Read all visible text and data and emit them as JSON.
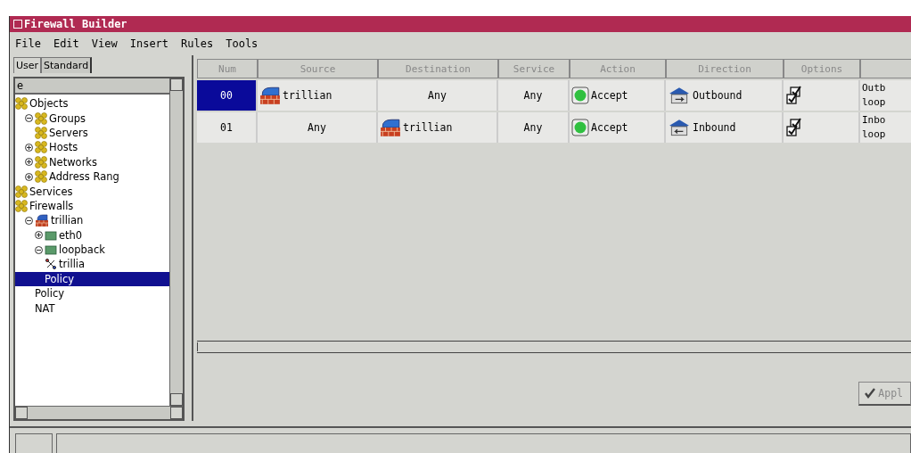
{
  "window": {
    "title": "Firewall Builder"
  },
  "menu": [
    "File",
    "Edit",
    "View",
    "Insert",
    "Rules",
    "Tools"
  ],
  "tabs": [
    {
      "label": "User",
      "selected": false
    },
    {
      "label": "Standard",
      "selected": true
    }
  ],
  "tree_header": "e",
  "tree": [
    {
      "label": "Objects",
      "kind": "group",
      "selected": false,
      "children": [
        {
          "label": "Groups",
          "kind": "group",
          "selected": false,
          "expanded": true,
          "children": [
            {
              "label": "Servers",
              "kind": "group",
              "selected": false
            }
          ]
        },
        {
          "label": "Hosts",
          "kind": "group",
          "selected": false,
          "expanded": false
        },
        {
          "label": "Networks",
          "kind": "group",
          "selected": false,
          "expanded": false
        },
        {
          "label": "Address Rang",
          "kind": "group",
          "selected": false,
          "expanded": false
        }
      ]
    },
    {
      "label": "Services",
      "kind": "group",
      "selected": false
    },
    {
      "label": "Firewalls",
      "kind": "group",
      "selected": false,
      "children": [
        {
          "label": "trillian",
          "kind": "firewall",
          "selected": false,
          "expanded": true,
          "children": [
            {
              "label": "eth0",
              "kind": "interface",
              "selected": false,
              "expanded": false
            },
            {
              "label": "loopback",
              "kind": "interface",
              "selected": false,
              "expanded": true,
              "children": [
                {
                  "label": "trillia",
                  "kind": "address",
                  "selected": false
                },
                {
                  "label": "Policy",
                  "kind": "policy",
                  "selected": true
                }
              ]
            },
            {
              "label": "Policy",
              "kind": "policy",
              "selected": false
            },
            {
              "label": "NAT",
              "kind": "policy",
              "selected": false
            }
          ]
        }
      ]
    }
  ],
  "table": {
    "columns": [
      "Num",
      "Source",
      "Destination",
      "Service",
      "Action",
      "Direction",
      "Options",
      ""
    ],
    "rows": [
      {
        "selected": true,
        "cells": [
          {
            "text": "00"
          },
          {
            "text": "trillian",
            "kind": "firewall"
          },
          {
            "text": "Any"
          },
          {
            "text": "Any"
          },
          {
            "text": "Accept",
            "kind": "accept"
          },
          {
            "text": "Outbound",
            "kind": "outbound"
          },
          {
            "kind": "options"
          },
          {
            "text": "Outb",
            "text2": "loop"
          }
        ]
      },
      {
        "selected": false,
        "cells": [
          {
            "text": "01"
          },
          {
            "text": "Any"
          },
          {
            "text": "trillian",
            "kind": "firewall"
          },
          {
            "text": "Any"
          },
          {
            "text": "Accept",
            "kind": "accept"
          },
          {
            "text": "Inbound",
            "kind": "inbound"
          },
          {
            "kind": "options"
          },
          {
            "text": "Inbo",
            "text2": "loop"
          }
        ]
      }
    ]
  },
  "apply_button": {
    "label": "Appl",
    "disabled": true
  }
}
